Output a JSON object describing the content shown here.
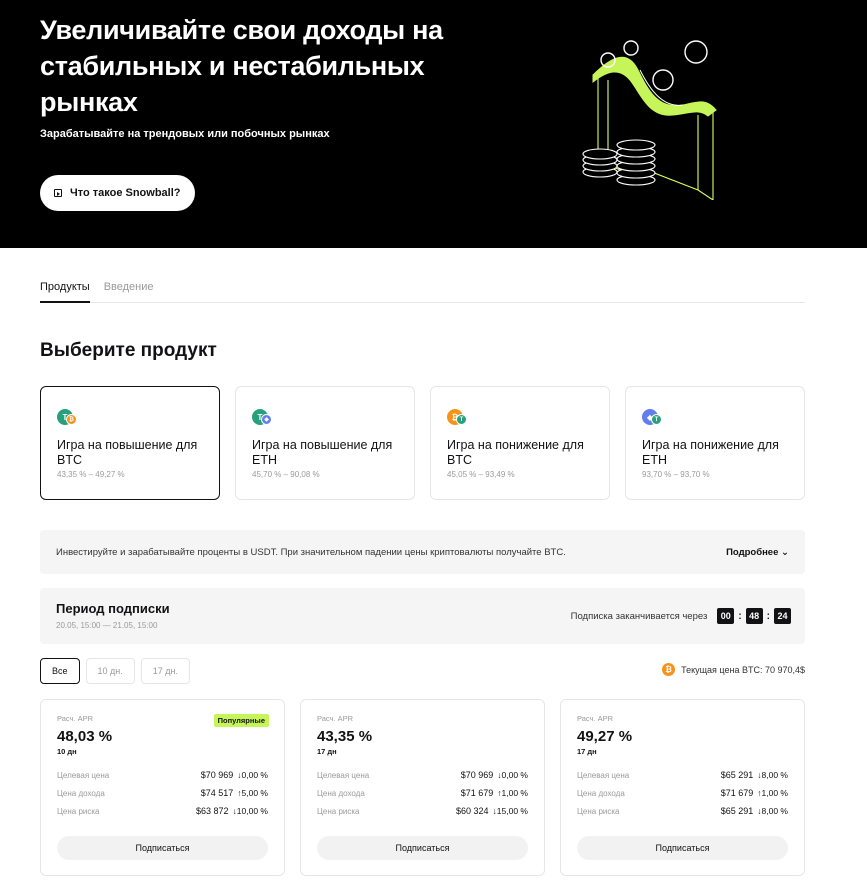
{
  "hero": {
    "title": "Увеличивайте свои доходы на стабильных и нестабильных рынках",
    "subtitle": "Зарабатывайте на трендовых или побочных рынках",
    "button_label": "Что такое Snowball?"
  },
  "tabs": [
    {
      "label": "Продукты",
      "active": true
    },
    {
      "label": "Введение",
      "active": false
    }
  ],
  "section_title": "Выберите продукт",
  "products": [
    {
      "name": "Игра на повышение для BTC",
      "range": "43,35 % – 49,27 %",
      "coin_main": "T",
      "coin_sub": "₿",
      "main_color": "#26a17b",
      "sub_color": "#f7931a",
      "selected": true
    },
    {
      "name": "Игра на повышение для ETH",
      "range": "45,70 % – 90,08 %",
      "coin_main": "T",
      "coin_sub": "◆",
      "main_color": "#26a17b",
      "sub_color": "#627eea",
      "selected": false
    },
    {
      "name": "Игра на понижение для BTC",
      "range": "45,05 % – 93,49 %",
      "coin_main": "₿",
      "coin_sub": "T",
      "main_color": "#f7931a",
      "sub_color": "#26a17b",
      "selected": false
    },
    {
      "name": "Игра на понижение для ETH",
      "range": "93,70 % – 93,70 %",
      "coin_main": "◆",
      "coin_sub": "T",
      "main_color": "#627eea",
      "sub_color": "#26a17b",
      "selected": false
    }
  ],
  "info_bar": {
    "text": "Инвестируйте и зарабатывайте проценты в USDT. При значительном падении цены криптовалюты получайте BTC.",
    "more": "Подробнее"
  },
  "period": {
    "title": "Период подписки",
    "dates": "20.05, 15:00 — 21.05, 15:00",
    "countdown_label": "Подписка заканчивается через",
    "hh": "00",
    "mm": "48",
    "ss": "24"
  },
  "filters": [
    {
      "label": "Все",
      "active": true
    },
    {
      "label": "10 дн.",
      "active": false
    },
    {
      "label": "17 дн.",
      "active": false
    }
  ],
  "btc_price": "Текущая цена BTC: 70 970,4$",
  "cards": [
    {
      "apr_label": "Расч. APR",
      "apr": "48,03 %",
      "days": "10 дн",
      "badge": "Популярные",
      "rows": [
        {
          "k": "Целевая цена",
          "price": "$70 969",
          "pct": "↓0,00 %"
        },
        {
          "k": "Цена дохода",
          "price": "$74 517",
          "pct": "↑5,00 %"
        },
        {
          "k": "Цена риска",
          "price": "$63 872",
          "pct": "↓10,00 %"
        }
      ],
      "button": "Подписаться"
    },
    {
      "apr_label": "Расч. APR",
      "apr": "43,35 %",
      "days": "17 дн",
      "badge": "",
      "rows": [
        {
          "k": "Целевая цена",
          "price": "$70 969",
          "pct": "↓0,00 %"
        },
        {
          "k": "Цена дохода",
          "price": "$71 679",
          "pct": "↑1,00 %"
        },
        {
          "k": "Цена риска",
          "price": "$60 324",
          "pct": "↓15,00 %"
        }
      ],
      "button": "Подписаться"
    },
    {
      "apr_label": "Расч. APR",
      "apr": "49,27 %",
      "days": "17 дн",
      "badge": "",
      "rows": [
        {
          "k": "Целевая цена",
          "price": "$65 291",
          "pct": "↓8,00 %"
        },
        {
          "k": "Цена дохода",
          "price": "$71 679",
          "pct": "↑1,00 %"
        },
        {
          "k": "Цена риска",
          "price": "$65 291",
          "pct": "↓8,00 %"
        }
      ],
      "button": "Подписаться"
    }
  ]
}
